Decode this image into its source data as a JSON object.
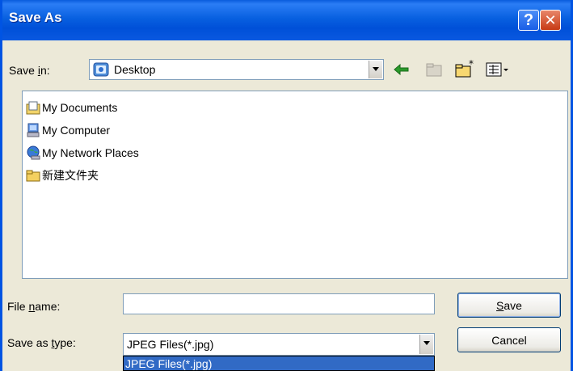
{
  "window": {
    "title": "Save As"
  },
  "title_buttons": {
    "help": "?",
    "close": "✕"
  },
  "save_in": {
    "label_pre": "Save ",
    "label_hot": "i",
    "label_post": "n:",
    "value": "Desktop",
    "icon": "desktop-icon"
  },
  "toolbar": {
    "icons": [
      "back-arrow-icon",
      "up-folder-icon",
      "new-folder-icon",
      "views-menu-icon"
    ]
  },
  "files": [
    {
      "label": "My Documents",
      "icon": "my-documents-icon"
    },
    {
      "label": "My Computer",
      "icon": "my-computer-icon"
    },
    {
      "label": "My Network Places",
      "icon": "network-places-icon"
    },
    {
      "label": "新建文件夹",
      "icon": "folder-icon"
    }
  ],
  "file_name": {
    "label_pre": "File ",
    "label_hot": "n",
    "label_post": "ame:",
    "value": ""
  },
  "save_as_type": {
    "label_pre": "Save as ",
    "label_hot": "t",
    "label_post": "ype:",
    "value": "JPEG Files(*.jpg)",
    "open_option": "JPEG Files(*.jpg)"
  },
  "buttons": {
    "save_hot": "S",
    "save_rest": "ave",
    "cancel": "Cancel"
  },
  "colors": {
    "title_bar": "#0a5ddc",
    "dialog_bg": "#ece9d8",
    "selection": "#316ac5"
  }
}
